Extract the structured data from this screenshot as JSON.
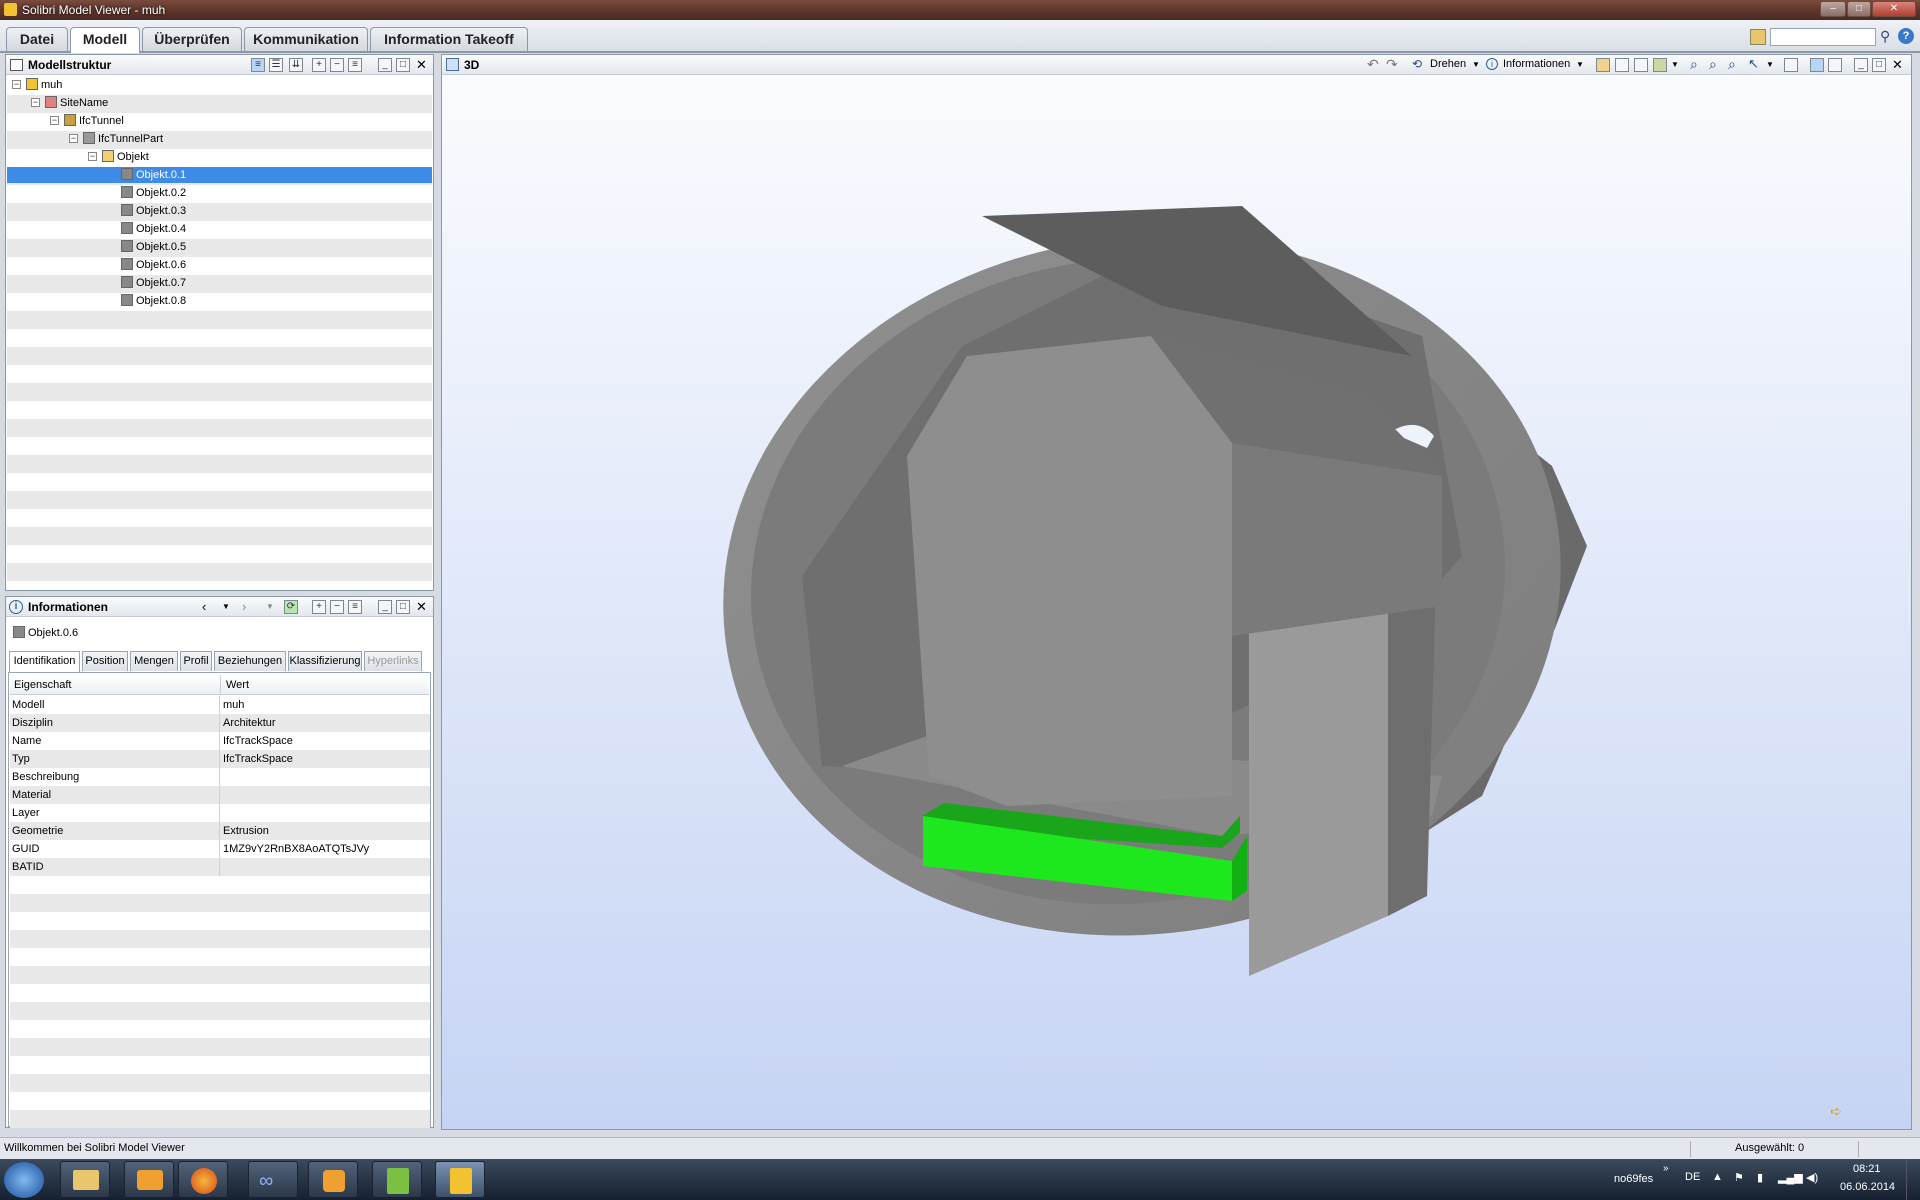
{
  "window": {
    "title": "Solibri Model Viewer - muh"
  },
  "ribbon_tabs": [
    "Datei",
    "Modell",
    "Überprüfen",
    "Kommunikation",
    "Information Takeoff"
  ],
  "active_tab": "Modell",
  "model_tree": {
    "title": "Modellstruktur",
    "items": [
      {
        "label": "muh",
        "level": 0,
        "icon": "house-icon",
        "expandable": true
      },
      {
        "label": "SiteName",
        "level": 1,
        "icon": "site-icon",
        "expandable": true
      },
      {
        "label": "IfcTunnel",
        "level": 2,
        "icon": "building-icon",
        "expandable": true
      },
      {
        "label": "IfcTunnelPart",
        "level": 3,
        "icon": "storey-icon",
        "expandable": true
      },
      {
        "label": "Objekt",
        "level": 4,
        "icon": "folder-icon",
        "expandable": true
      },
      {
        "label": "Objekt.0.1",
        "level": 5,
        "icon": "object-icon",
        "selected": true
      },
      {
        "label": "Objekt.0.2",
        "level": 5,
        "icon": "object-icon"
      },
      {
        "label": "Objekt.0.3",
        "level": 5,
        "icon": "object-icon"
      },
      {
        "label": "Objekt.0.4",
        "level": 5,
        "icon": "object-icon"
      },
      {
        "label": "Objekt.0.5",
        "level": 5,
        "icon": "object-icon"
      },
      {
        "label": "Objekt.0.6",
        "level": 5,
        "icon": "object-icon"
      },
      {
        "label": "Objekt.0.7",
        "level": 5,
        "icon": "object-icon"
      },
      {
        "label": "Objekt.0.8",
        "level": 5,
        "icon": "object-icon"
      }
    ]
  },
  "info_panel": {
    "title": "Informationen",
    "object": "Objekt.0.6",
    "tabs": [
      "Identifikation",
      "Position",
      "Mengen",
      "Profil",
      "Beziehungen",
      "Klassifizierung",
      "Hyperlinks"
    ],
    "active_tab": "Identifikation",
    "headers": {
      "property": "Eigenschaft",
      "value": "Wert"
    },
    "rows": [
      {
        "k": "Modell",
        "v": "muh"
      },
      {
        "k": "Disziplin",
        "v": "Architektur"
      },
      {
        "k": "Name",
        "v": "IfcTrackSpace"
      },
      {
        "k": "Typ",
        "v": "IfcTrackSpace"
      },
      {
        "k": "Beschreibung",
        "v": ""
      },
      {
        "k": "Material",
        "v": ""
      },
      {
        "k": "Layer",
        "v": ""
      },
      {
        "k": "Geometrie",
        "v": "Extrusion"
      },
      {
        "k": "GUID",
        "v": "1MZ9vY2RnBX8AoATQTsJVy"
      },
      {
        "k": "BATID",
        "v": ""
      }
    ]
  },
  "view3d": {
    "title": "3D",
    "toolbar": {
      "rotate": "Drehen",
      "info": "Informationen"
    },
    "highlight_color": "#1de81d",
    "model_color": "#8e8e8e"
  },
  "statusbar": {
    "message": "Willkommen bei Solibri Model Viewer",
    "selected": "Ausgewählt: 0"
  },
  "taskbar": {
    "user": "no69fes",
    "lang": "DE",
    "time": "08:21",
    "date": "06.06.2014"
  }
}
